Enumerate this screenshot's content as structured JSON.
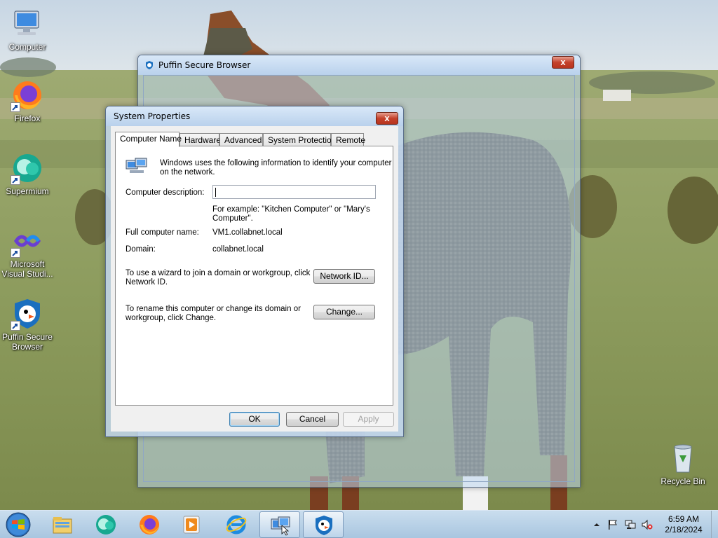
{
  "desktop": {
    "icons": [
      {
        "label": "Computer",
        "icon": "computer-icon"
      },
      {
        "label": "Firefox",
        "icon": "firefox-icon"
      },
      {
        "label": "Supermium",
        "icon": "supermium-icon"
      },
      {
        "label": "Microsoft Visual Studio...",
        "label_line1": "Microsoft",
        "label_line2": "Visual Studi...",
        "icon": "visual-studio-icon"
      },
      {
        "label": "Puffin Secure Browser",
        "label_line1": "Puffin Secure",
        "label_line2": "Browser",
        "icon": "puffin-icon"
      },
      {
        "label": "Recycle Bin",
        "icon": "recycle-bin-icon"
      }
    ]
  },
  "puffin_window": {
    "title": "Puffin Secure Browser",
    "close_label": "x"
  },
  "system_properties": {
    "title": "System Properties",
    "close_label": "x",
    "tabs": [
      {
        "label": "Computer Name",
        "active": true
      },
      {
        "label": "Hardware"
      },
      {
        "label": "Advanced"
      },
      {
        "label": "System Protection"
      },
      {
        "label": "Remote"
      }
    ],
    "intro_line1": "Windows uses the following information to identify your computer",
    "intro_line2": "on the network.",
    "description_label": "Computer description:",
    "description_value": "",
    "example_line1": "For example: \"Kitchen Computer\" or \"Mary's",
    "example_line2": "Computer\".",
    "full_name_label": "Full computer name:",
    "full_name_value": "VM1.collabnet.local",
    "domain_label": "Domain:",
    "domain_value": "collabnet.local",
    "wizard_line1": "To use a wizard to join a domain or workgroup, click",
    "wizard_line2": "Network ID.",
    "network_id_button": "Network ID...",
    "rename_line1": "To rename this computer or change its domain or",
    "rename_line2": "workgroup, click Change.",
    "change_button": "Change...",
    "ok_button": "OK",
    "cancel_button": "Cancel",
    "apply_button": "Apply"
  },
  "taskbar": {
    "pinned": [
      "windows-explorer-icon",
      "supermium-icon",
      "firefox-icon",
      "media-player-icon",
      "internet-explorer-icon"
    ],
    "open": [
      "system-properties-icon",
      "puffin-icon"
    ],
    "tray": [
      "show-hidden-icons",
      "action-center-flag-icon",
      "network-icon",
      "volume-muted-icon"
    ],
    "time": "6:59 AM",
    "date": "2/18/2024"
  },
  "colors": {
    "title_bar": "#c4d8ef",
    "close_button": "#c4412b",
    "taskbar": "#b8d0ea"
  }
}
